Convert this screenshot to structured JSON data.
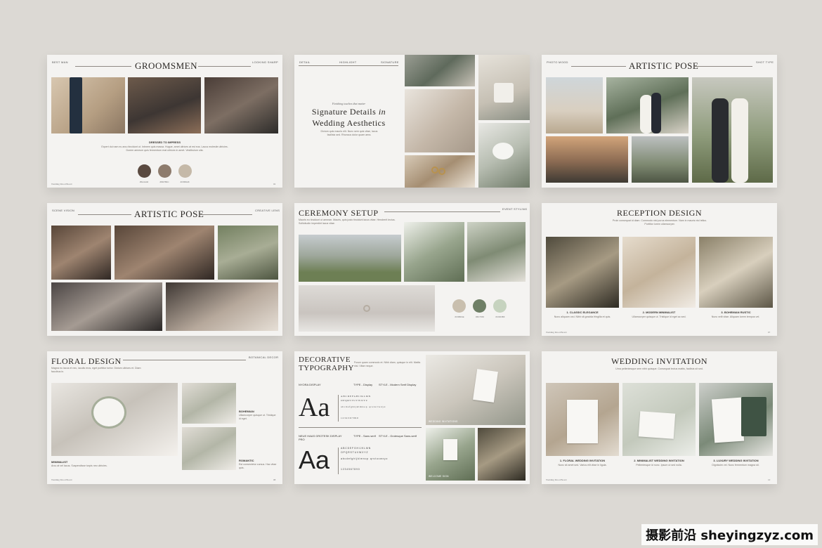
{
  "slides": {
    "groomsmen": {
      "label_left": "BEST MAN",
      "title": "GROOMSMEN",
      "label_right": "LOOKING SHARP",
      "caption": "DRESSED TO IMPRESS",
      "body": "Expert dui nam eu arcu tincidunt ut. Inbnem quis massa. Hugue, amet ultrices at est eus. Lacus molestie ultricies. Dorem aeneum quis fermentum erat ultrices in amet. Vestibulum ulla.",
      "swatches": [
        {
          "color": "#5a4a40",
          "label": "#5A4A40"
        },
        {
          "color": "#8d7b6c",
          "label": "#8D7B6C"
        },
        {
          "color": "#c5b9a8",
          "label": "#C5B9A8"
        }
      ],
      "footer": "Wedding Mood Board",
      "page": "02"
    },
    "details": {
      "labels": [
        "DETAIL",
        "HIGHLIGHT",
        "SIGNATURE"
      ],
      "kicker": "Finishing touches that matter",
      "title_1": "Signature Details",
      "title_in": "in",
      "title_2": "Wedding Aesthetics",
      "body": "Dictum quis mauris elit. Nunc sem quis vitae, lacus facilisis sed. Rhoncus dolor quam aera."
    },
    "artistic1": {
      "label_left": "PHOTO MOOD",
      "title": "ARTISTIC POSE",
      "label_right": "SHOT TYPE"
    },
    "artistic2": {
      "label_left": "SCENE VISION",
      "title": "ARTISTIC POSE",
      "label_right": "CREATIVE LENS"
    },
    "ceremony": {
      "title": "CEREMONY SETUP",
      "label_right": "EVENT STYLING",
      "body": "Mauris eu tincidunt ut aenean. Mauris, quis justo tincidunt lacus vitae. Hendrerit lectus. Sollicitudin imperdiet lacus vitae.",
      "swatches": [
        {
          "color": "#c9bfae",
          "label": "#C9BFAE"
        },
        {
          "color": "#6f7f66",
          "label": "#6F7F66"
        },
        {
          "color": "#c6d3bf",
          "label": "#C6D3BF"
        }
      ]
    },
    "reception": {
      "title": "RECEPTION DESIGN",
      "body": "Proin consequat id diam. Commodo nisl purus elementum. Nam in mauris nisl tellus. Porttitor lorem ullamcorper.",
      "items": [
        {
          "label": "1. CLASSIC ELEGANCE",
          "text": "Nunc aliquam orci. Nibh sit gravida fringilla et quis."
        },
        {
          "label": "2. MODERN MINIMALIST",
          "text": "Ullamcorper quisque ut. Tristique id eget ac sed."
        },
        {
          "label": "3. BOHEMIAN RUSTIC",
          "text": "Nunc velit vitae. Aliquam lorem tempus vel."
        }
      ],
      "footer": "Wedding Mood Board",
      "page": "07"
    },
    "floral": {
      "title": "FLORAL DESIGN",
      "label_right": "BOTANICAL DECOR",
      "body": "Magna eu lacus et nec, iaculis eros, eget porttitor tortor. Dictum ultrices et. Diam faucibus in.",
      "items": [
        {
          "label": "MINIMALIST",
          "text": "Arcu at vel lacus. Suspendisse turpis nec ultricies."
        },
        {
          "label": "BOHEMIAN",
          "text": "Ullamcorper quisque ut. Tristique id eget."
        },
        {
          "label": "ROMANTIC",
          "text": "Est consectetur cursus. Hac vitae quis."
        }
      ],
      "footer": "Wedding Mood Board",
      "page": "08"
    },
    "typography": {
      "title_1": "DECORATIVE",
      "title_2": "TYPOGRAPHY",
      "body": "Fusce quam commodo et. Nibh diam, quisque in elit. Mattis nisl. Vitae neque.",
      "font1_name": "NYORA DISPLAY",
      "font1_type": "TYPE - Display",
      "font1_style": "STYLE - Modern Serif Display",
      "font2_name": "NEUE HAAS GROTESK DISPLAY PRO",
      "font2_type": "TYPE - Sans serif",
      "font2_style": "STYLE - Grotesque Sans-serif",
      "specimen": "Aa",
      "glyphs_upper": "ABCDEFGHIJKLMN OPQRSTUVWXYZ",
      "glyphs_lower": "abcdefghijklmnop qrstuvwxyz",
      "glyphs_num": "1234567890",
      "photo_caption_1": "WEDDING INVITATIONS",
      "photo_caption_2": "WELCOME SIGN"
    },
    "invitation": {
      "title": "WEDDING INVITATION",
      "body": "Urna pellentesque sem nibh quisque. Consequat lectus mattis, facilisis sit sed.",
      "items": [
        {
          "label": "1. FLORAL WEDDING INVITATION",
          "text": "Nunc sit amet sed. Varius elit vitae in ligula."
        },
        {
          "label": "2. MINIMALIST WEDDING INVITATION",
          "text": "Pellentesque id nunc. Ipsum ut sed nulla."
        },
        {
          "label": "3. LUXURY WEDDING INVITATION",
          "text": "Dignissim vel. Nunc fermentum magna sit."
        }
      ],
      "footer": "Wedding Mood Board",
      "page": "10"
    }
  },
  "watermark": "摄影前沿 sheyingzyz.com"
}
